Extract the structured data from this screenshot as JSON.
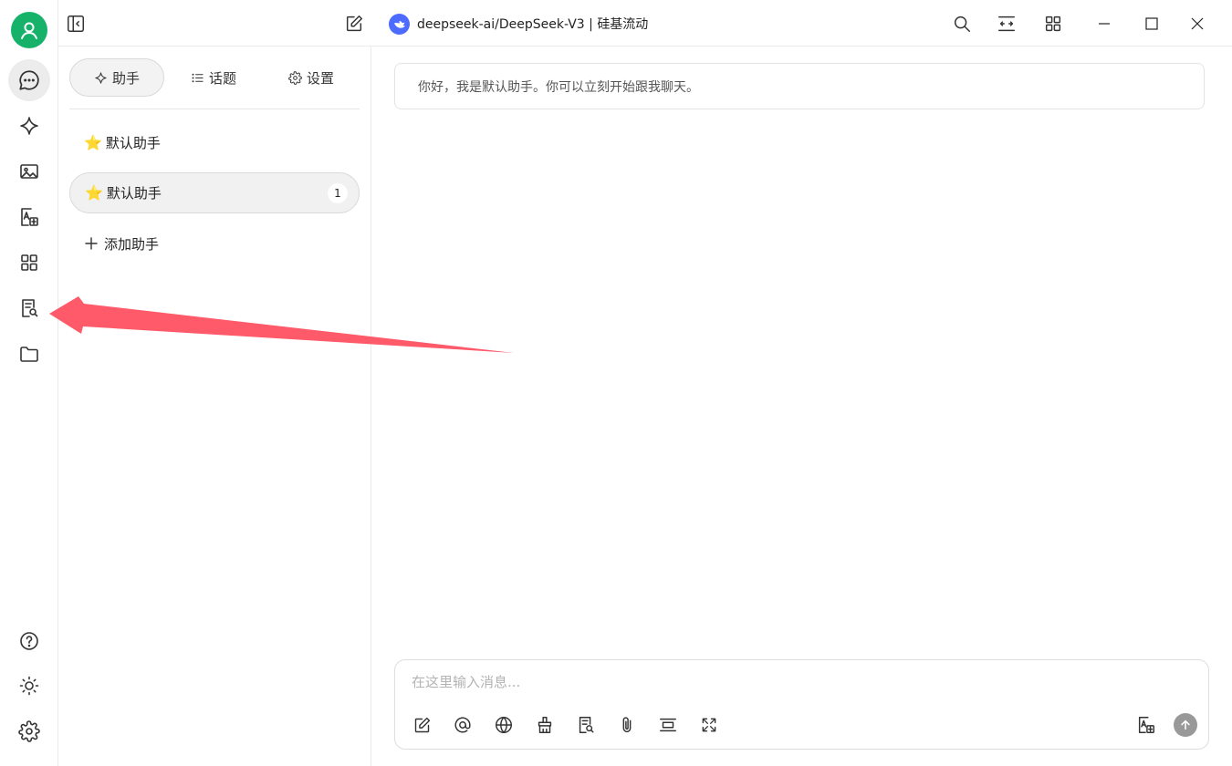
{
  "titlebar": {
    "model_title": "deepseek-ai/DeepSeek-V3 | 硅基流动"
  },
  "panel": {
    "tabs": [
      {
        "label": "助手",
        "icon": "sparkle-icon"
      },
      {
        "label": "话题",
        "icon": "list-icon"
      },
      {
        "label": "设置",
        "icon": "gear-icon"
      }
    ],
    "assistants": [
      {
        "label": "默认助手",
        "icon": "star-icon"
      },
      {
        "label": "默认助手",
        "icon": "star-icon",
        "badge": "1",
        "selected": true
      }
    ],
    "add_label": "添加助手"
  },
  "chat": {
    "welcome_message": "你好，我是默认助手。你可以立刻开始跟我聊天。",
    "input_placeholder": "在这里输入消息..."
  },
  "colors": {
    "avatar": "#17b26a",
    "annotation_arrow": "#ff5a6a",
    "model_logo": "#4d6bfe"
  }
}
